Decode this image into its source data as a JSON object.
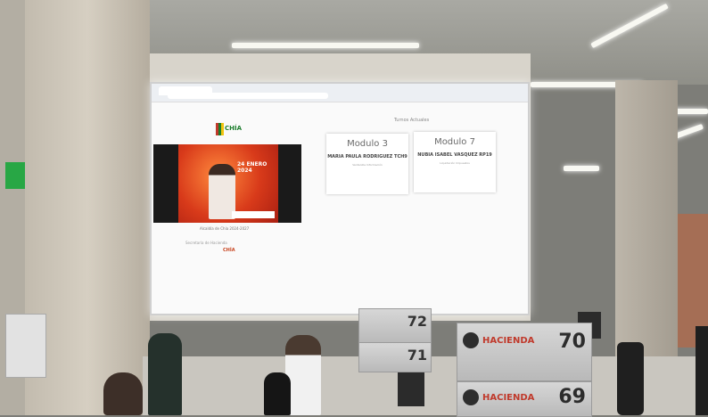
{
  "screen": {
    "queue_title": "Turnos Actuales",
    "modules": [
      {
        "title": "Modulo 3",
        "name": "MARIA PAULA RODRIGUEZ TCH9",
        "sub": "Ventanilla Información"
      },
      {
        "title": "Modulo 7",
        "name": "NUBIA ISABEL VASQUEZ RP19",
        "sub": "Liquidación Impuestos"
      }
    ],
    "logo_text": "CHÍA",
    "promo": {
      "headline": "24 ENERO 2024"
    },
    "captions": [
      "Alcaldía de Chía 2024-2027",
      "Secretaría de Hacienda",
      "CHÍA"
    ]
  },
  "signs": [
    {
      "brand": "HACIENDA",
      "number": "70"
    },
    {
      "brand": "HACIENDA",
      "number": "69"
    },
    {
      "number": "72"
    },
    {
      "number": "71"
    }
  ],
  "colors": {
    "brand_red": "#c0392b",
    "brand_green": "#1b7d2c",
    "screen_bg": "#fafafa"
  }
}
